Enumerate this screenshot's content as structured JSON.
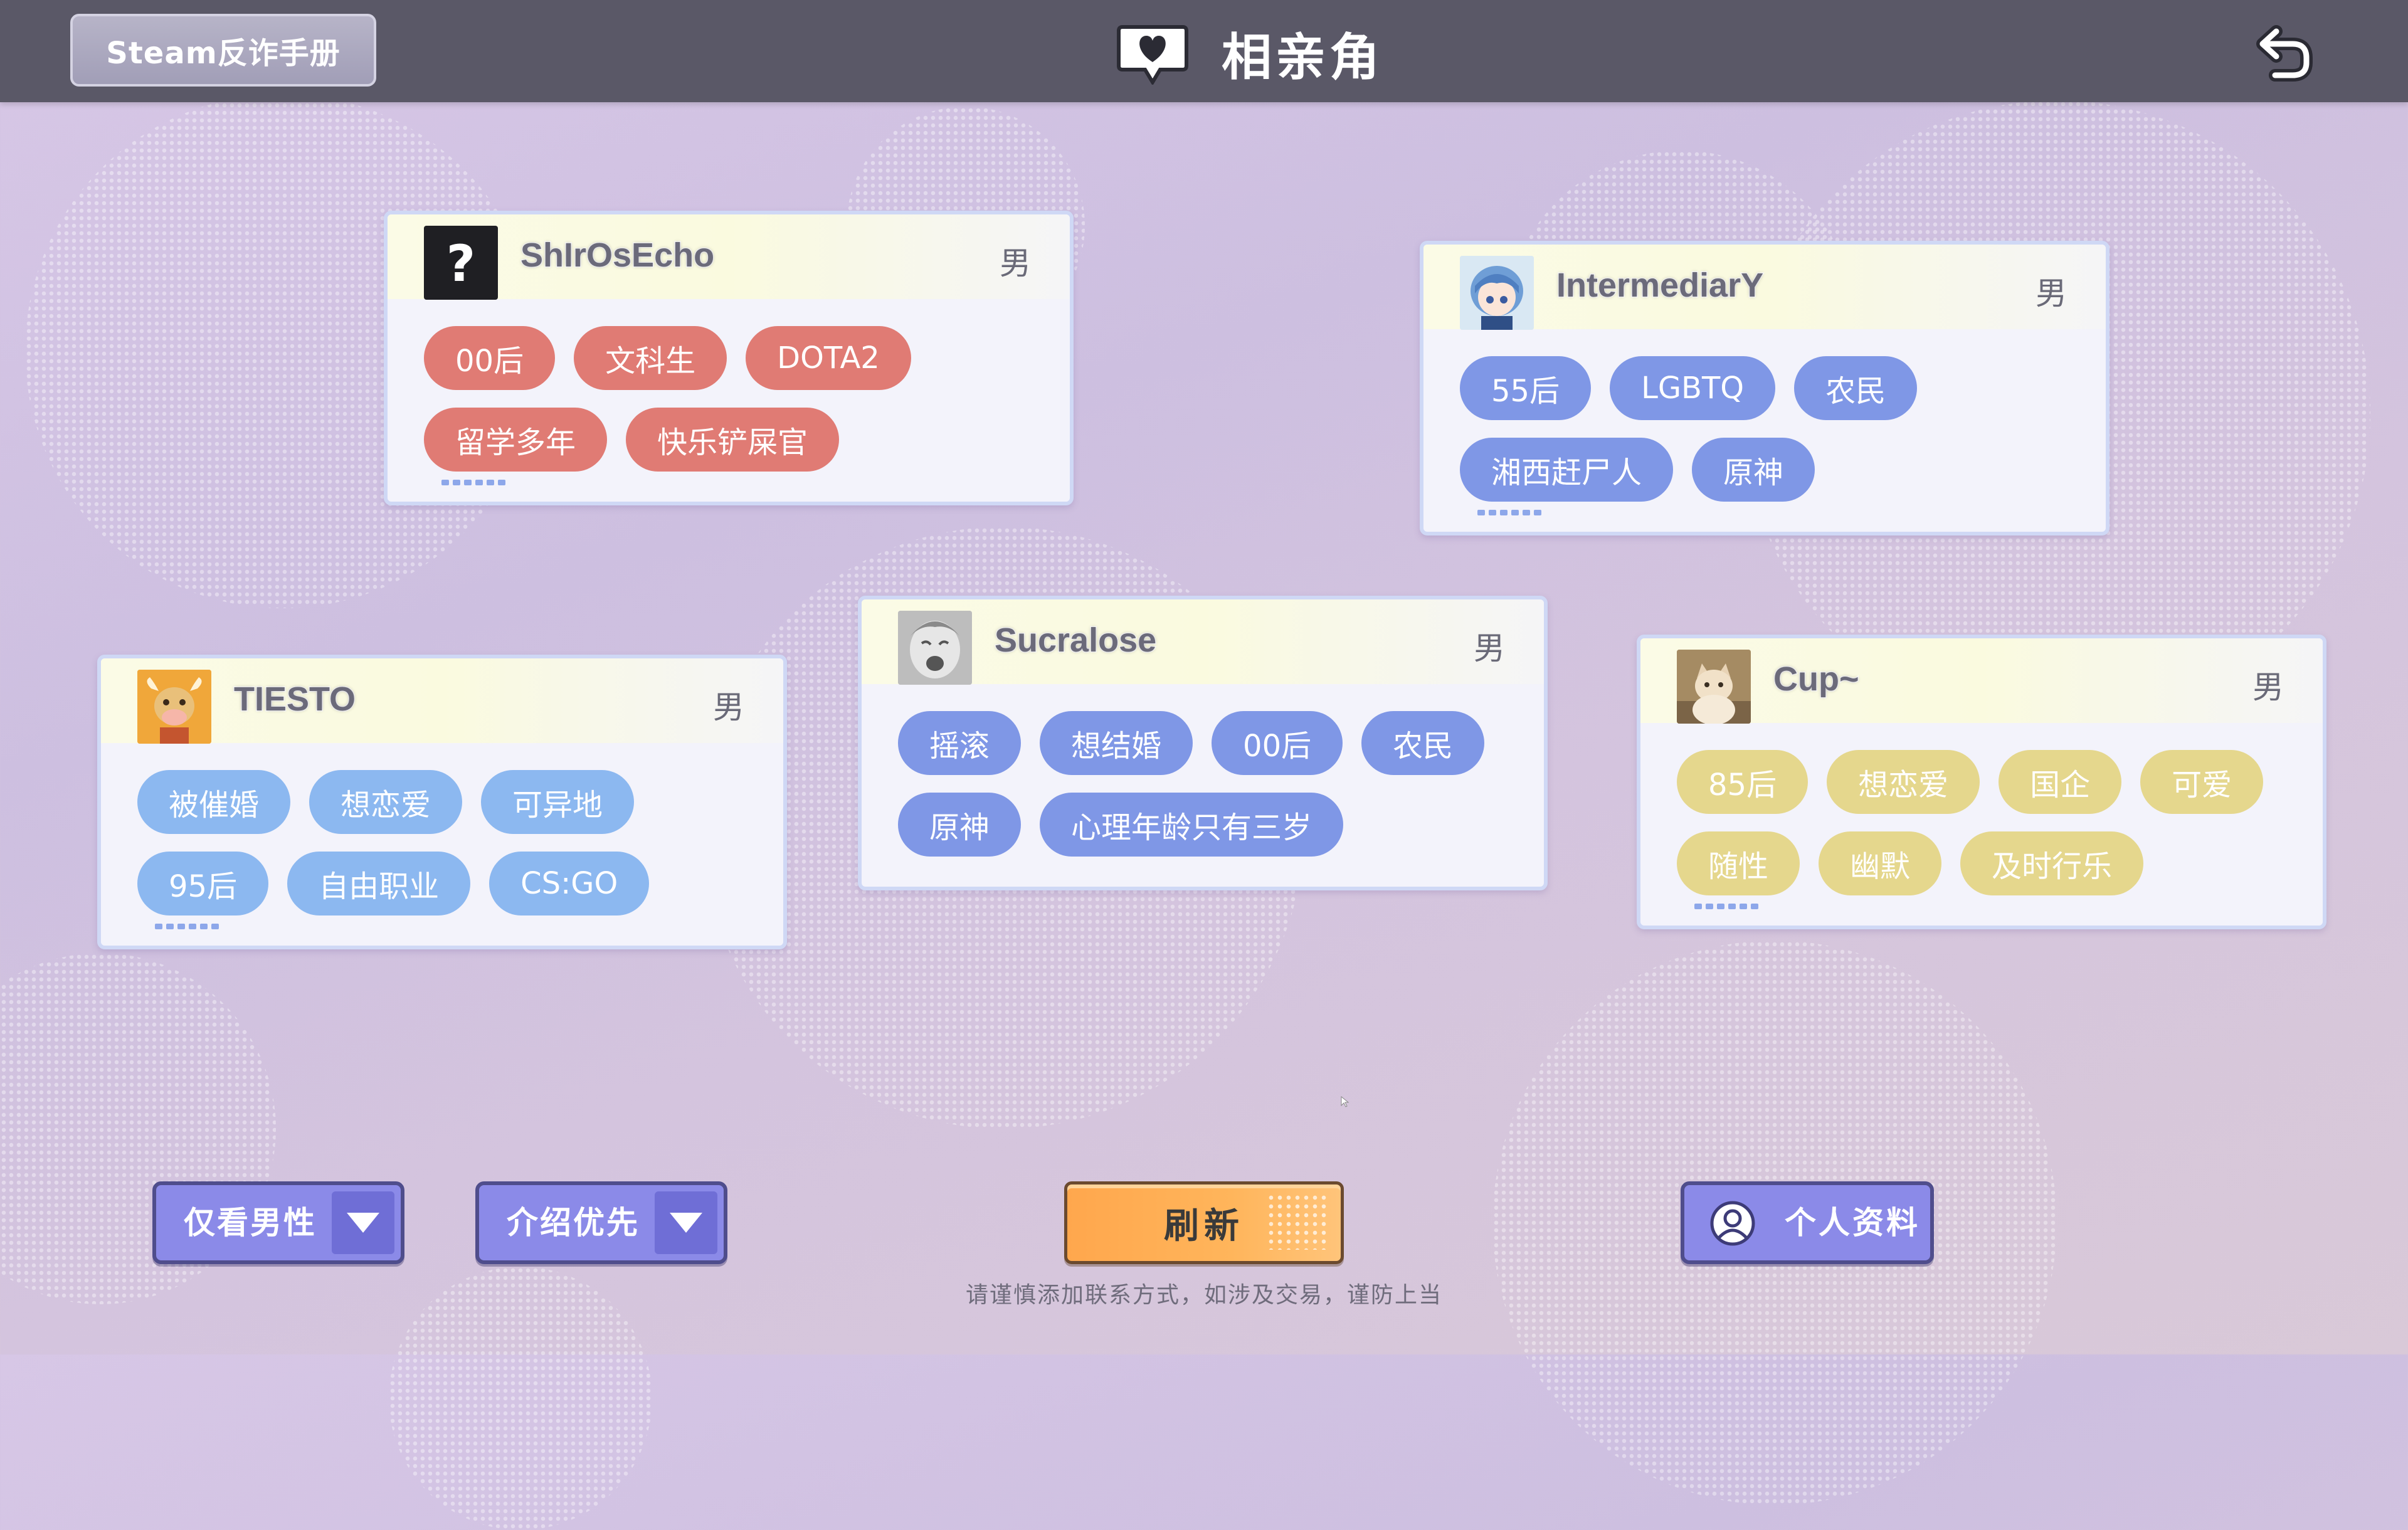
{
  "top_bar": {
    "guide_button": "Steam反诈手册",
    "title": "相亲角"
  },
  "cards": [
    {
      "username": "ShIrOsEcho",
      "gender": "男",
      "avatar": "question-mark",
      "tag_color": "#e07b74",
      "tags": [
        "00后",
        "文科生",
        "DOTA2",
        "留学多年",
        "快乐铲屎官"
      ]
    },
    {
      "username": "IntermediarY",
      "gender": "男",
      "avatar": "anime-girl",
      "tag_color": "#7f97e6",
      "tags": [
        "55后",
        "LGBTQ",
        "农民",
        "湘西赶尸人",
        "原神"
      ]
    },
    {
      "username": "TIESTO",
      "gender": "男",
      "avatar": "cow",
      "tag_color": "#8cb8f0",
      "tags": [
        "被催婚",
        "想恋爱",
        "可异地",
        "95后",
        "自由职业",
        "CS:GO"
      ]
    },
    {
      "username": "Sucralose",
      "gender": "男",
      "avatar": "crying-baby",
      "tag_color": "#7f97e6",
      "tags": [
        "摇滚",
        "想结婚",
        "00后",
        "农民",
        "原神",
        "心理年龄只有三岁"
      ]
    },
    {
      "username": "Cup~",
      "gender": "男",
      "avatar": "cat",
      "tag_color": "#e5d78d",
      "tags": [
        "85后",
        "想恋爱",
        "国企",
        "可爱",
        "随性",
        "幽默",
        "及时行乐"
      ]
    }
  ],
  "bottom": {
    "gender_filter": "仅看男性",
    "sort_filter": "介绍优先",
    "refresh_button": "刷新",
    "warning": "请谨慎添加联系方式，如涉及交易，谨防上当",
    "profile_button": "个人资料"
  }
}
